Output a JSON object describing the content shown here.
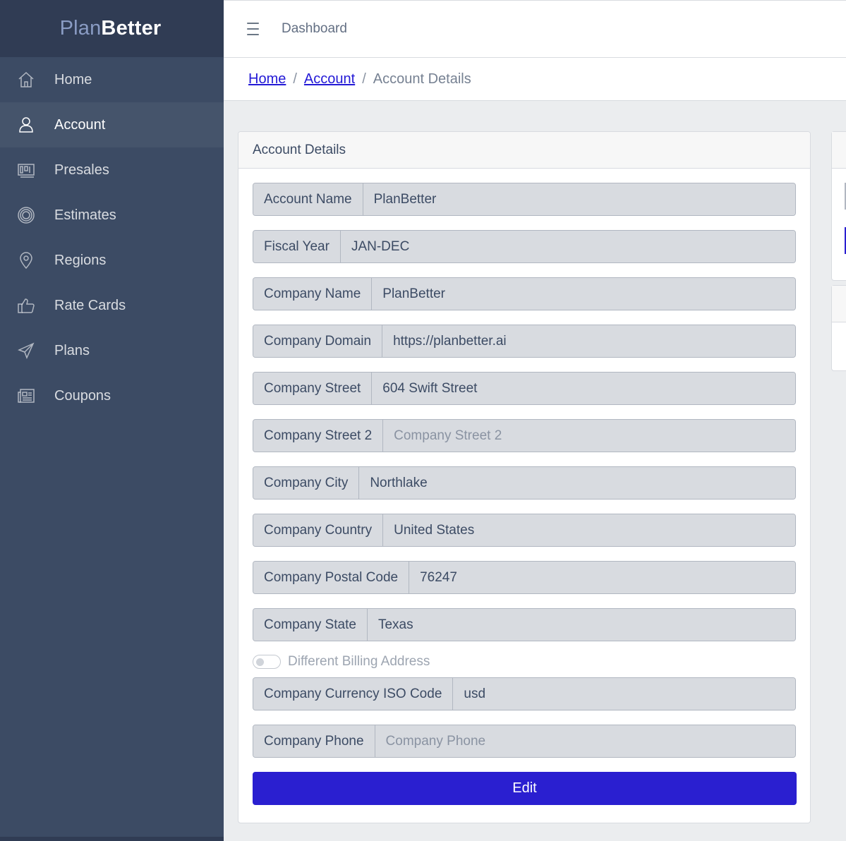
{
  "brand": {
    "part1": "Plan",
    "part2": "Better"
  },
  "sidebar": {
    "items": [
      {
        "label": "Home",
        "icon": "home-icon"
      },
      {
        "label": "Account",
        "icon": "user-icon",
        "active": true
      },
      {
        "label": "Presales",
        "icon": "presales-icon"
      },
      {
        "label": "Estimates",
        "icon": "estimates-icon"
      },
      {
        "label": "Regions",
        "icon": "location-pin-icon"
      },
      {
        "label": "Rate Cards",
        "icon": "thumbs-up-icon"
      },
      {
        "label": "Plans",
        "icon": "paper-plane-icon"
      },
      {
        "label": "Coupons",
        "icon": "newspaper-icon"
      }
    ]
  },
  "header": {
    "title": "Dashboard",
    "menu_icon": "hamburger-icon"
  },
  "breadcrumb": {
    "home": "Home",
    "account": "Account",
    "current": "Account Details",
    "separator": "/"
  },
  "card": {
    "title": "Account Details",
    "fields": [
      {
        "label": "Account Name",
        "value": "PlanBetter",
        "placeholder": ""
      },
      {
        "label": "Fiscal Year",
        "value": "JAN-DEC",
        "placeholder": ""
      },
      {
        "label": "Company Name",
        "value": "PlanBetter",
        "placeholder": ""
      },
      {
        "label": "Company Domain",
        "value": "https://planbetter.ai",
        "placeholder": ""
      },
      {
        "label": "Company Street",
        "value": "604 Swift Street",
        "placeholder": ""
      },
      {
        "label": "Company Street 2",
        "value": "",
        "placeholder": "Company Street 2"
      },
      {
        "label": "Company City",
        "value": "Northlake",
        "placeholder": ""
      },
      {
        "label": "Company Country",
        "value": "United States",
        "placeholder": ""
      },
      {
        "label": "Company Postal Code",
        "value": "76247",
        "placeholder": ""
      },
      {
        "label": "Company State",
        "value": "Texas",
        "placeholder": ""
      }
    ],
    "toggle": {
      "label": "Different Billing Address",
      "checked": false
    },
    "fields2": [
      {
        "label": "Company Currency ISO Code",
        "value": "usd",
        "placeholder": ""
      },
      {
        "label": "Company Phone",
        "value": "",
        "placeholder": "Company Phone"
      }
    ],
    "edit_label": "Edit"
  },
  "colors": {
    "sidebar_bg": "#3c4b64",
    "brand_bg": "#303c54",
    "primary": "#2a1fd0",
    "input_bg": "#d8dbe0"
  }
}
